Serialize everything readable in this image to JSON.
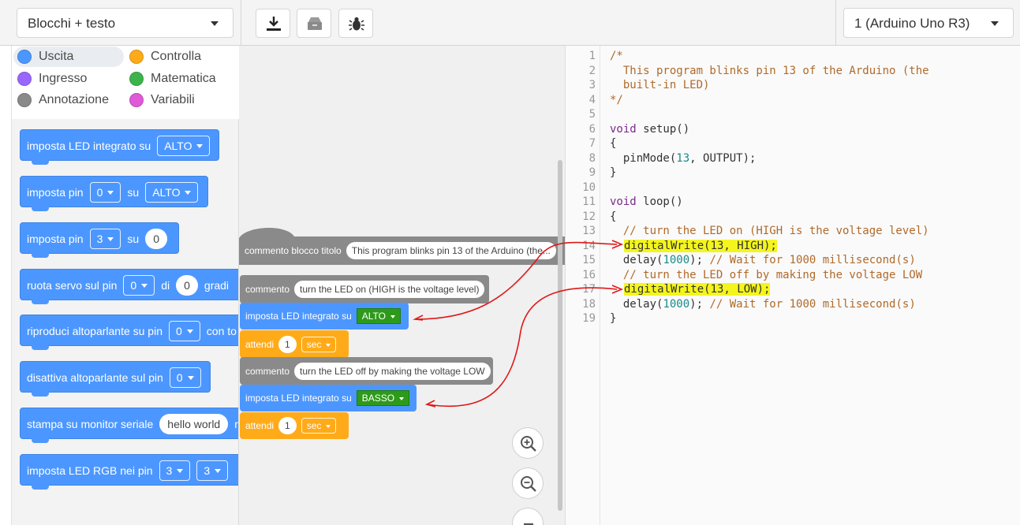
{
  "toolbar": {
    "mode_selected": "Blocchi + testo",
    "board_selected": "1 (Arduino Uno R3)",
    "download_icon": "download-icon",
    "upload_icon": "serial-monitor-icon",
    "debug_icon": "bug-icon"
  },
  "categories": [
    {
      "label": "Uscita",
      "color": "#4c97ff",
      "selected": true
    },
    {
      "label": "Controlla",
      "color": "#ffab19"
    },
    {
      "label": "Ingresso",
      "color": "#9966ff"
    },
    {
      "label": "Matematica",
      "color": "#3cb44b"
    },
    {
      "label": "Annotazione",
      "color": "#8a8a8a"
    },
    {
      "label": "Variabili",
      "color": "#e059d9"
    }
  ],
  "flyout": {
    "b1": {
      "text": "imposta LED integrato su",
      "dd": "ALTO"
    },
    "b2": {
      "text": "imposta pin",
      "dd1": "0",
      "mid": "su",
      "dd2": "ALTO"
    },
    "b3": {
      "text": "imposta pin",
      "dd1": "3",
      "mid": "su",
      "num": "0"
    },
    "b4": {
      "text": "ruota servo sul pin",
      "dd1": "0",
      "mid": "di",
      "num": "0",
      "tail": "gradi"
    },
    "b5": {
      "text": "riproduci altoparlante su pin",
      "dd1": "0",
      "tail": "con to"
    },
    "b6": {
      "text": "disattiva altoparlante sul pin",
      "dd1": "0"
    },
    "b7": {
      "text": "stampa su monitor seriale",
      "str": "hello world",
      "tail": "n"
    },
    "b8": {
      "text": "imposta LED RGB nei pin",
      "dd1": "3",
      "dd2": "3"
    }
  },
  "workspace": {
    "title_block": {
      "label": "commento blocco titolo",
      "text": "This program blinks pin 13 of the Arduino (the..."
    },
    "comment1": {
      "label": "commento",
      "text": "turn the LED on (HIGH is the voltage level)"
    },
    "set1": {
      "label": "imposta LED integrato su",
      "value": "ALTO"
    },
    "wait1": {
      "label": "attendi",
      "num": "1",
      "unit": "sec"
    },
    "comment2": {
      "label": "commento",
      "text": "turn the LED off by making the voltage LOW"
    },
    "set2": {
      "label": "imposta LED integrato su",
      "value": "BASSO"
    },
    "wait2": {
      "label": "attendi",
      "num": "1",
      "unit": "sec"
    }
  },
  "code": {
    "line_numbers": [
      "1",
      "2",
      "3",
      "4",
      "5",
      "6",
      "7",
      "8",
      "9",
      "10",
      "11",
      "12",
      "13",
      "14",
      "15",
      "16",
      "17",
      "18",
      "19"
    ],
    "l1": "/*",
    "l2": "  This program blinks pin 13 of the Arduino (the",
    "l3": "  built-in LED)",
    "l4": "*/",
    "l6_kw": "void",
    "l6_rest": " setup()",
    "l7": "{",
    "l8_a": "  pinMode(",
    "l8_n": "13",
    "l8_b": ", OUTPUT);",
    "l9": "}",
    "l11_kw": "void",
    "l11_rest": " loop()",
    "l12": "{",
    "l13": "  // turn the LED on (HIGH is the voltage level)",
    "l14": "digitalWrite(13, HIGH);",
    "l15_a": "  delay(",
    "l15_n": "1000",
    "l15_b": "); ",
    "l15_c": "// Wait for 1000 millisecond(s)",
    "l16": "  // turn the LED off by making the voltage LOW",
    "l17": "digitalWrite(13, LOW);",
    "l18_a": "  delay(",
    "l18_n": "1000",
    "l18_b": "); ",
    "l18_c": "// Wait for 1000 millisecond(s)",
    "l19": "}"
  },
  "colors": {
    "output_blue": "#4c97ff",
    "control_orange": "#ffab19",
    "annotation_grey": "#8a8a8a",
    "highlight_yellow": "#f4f51e",
    "arrow_red": "#e01818"
  }
}
